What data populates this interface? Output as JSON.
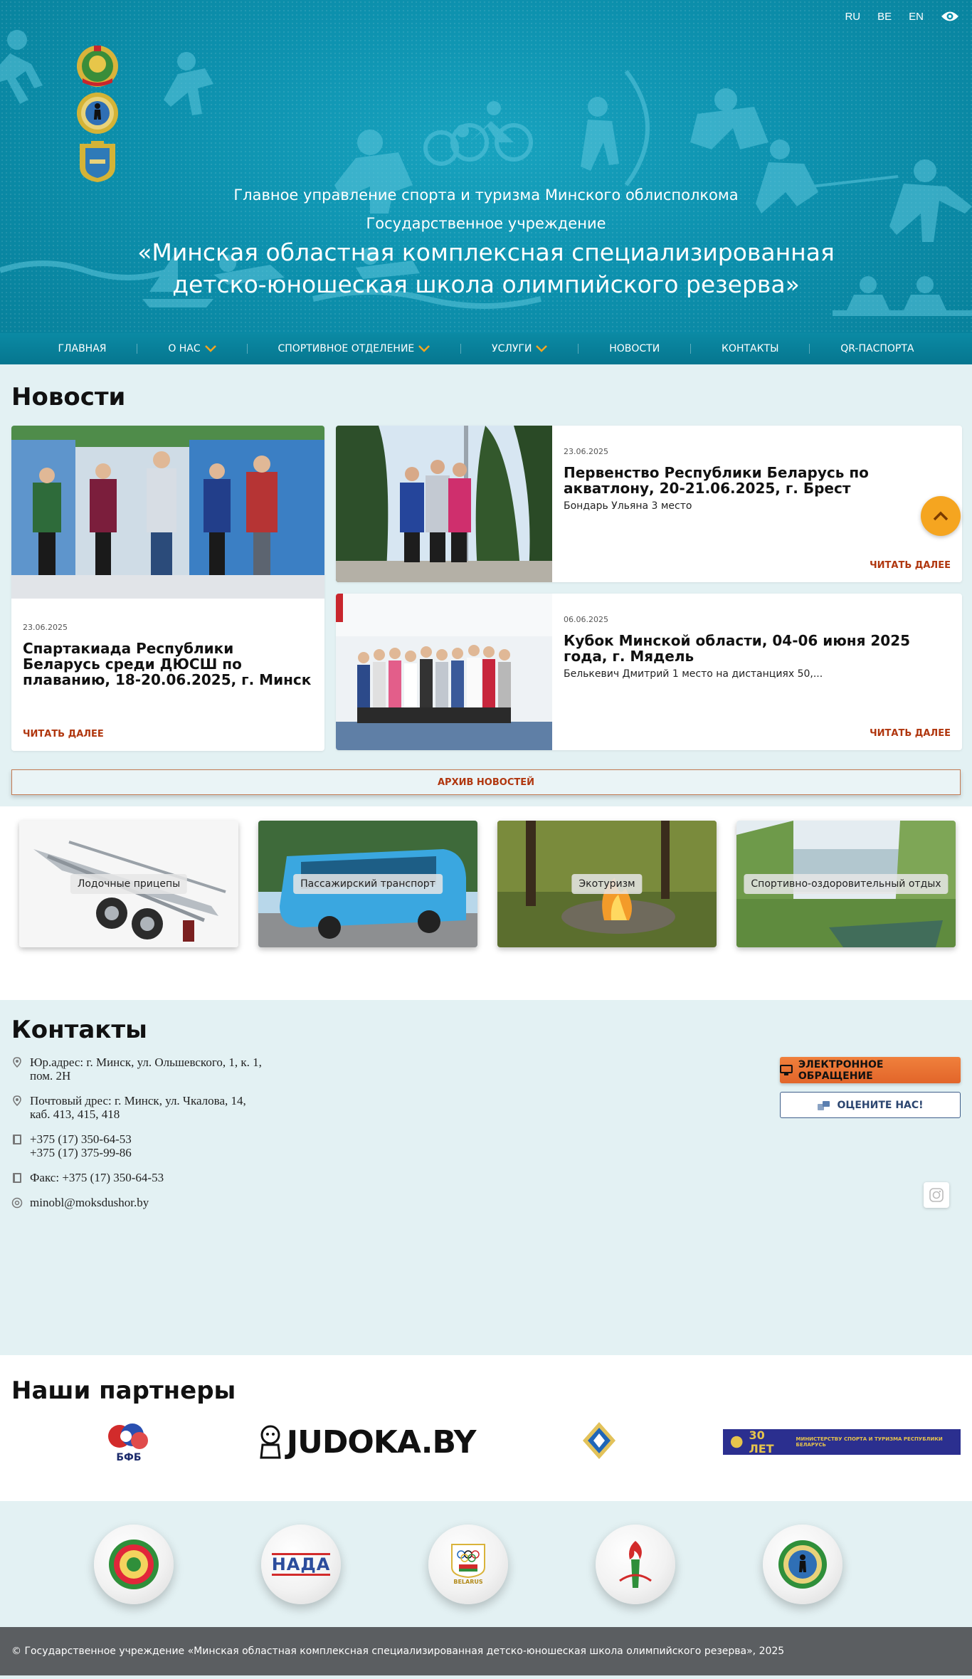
{
  "lang": [
    "RU",
    "BE",
    "EN"
  ],
  "header": {
    "line1": "Главное управление спорта и туризма Минского облисполкома",
    "line2": "Государственное учреждение",
    "line3": "«Минская областная комплексная специализированная детско-юношеская школа олимпийского резерва»"
  },
  "nav": [
    {
      "label": "Главная"
    },
    {
      "label": "О нас"
    },
    {
      "label": "Спортивное отделение"
    },
    {
      "label": "Услуги"
    },
    {
      "label": "Новости"
    },
    {
      "label": "Контакты"
    },
    {
      "label": "QR-паспорта"
    }
  ],
  "news": {
    "title": "Новости",
    "items": [
      {
        "date": "23.06.2025",
        "title": "Спартакиада Республики Беларусь среди ДЮСШ по плаванию, 18-20.06.2025, г. Минск",
        "excerpt": "",
        "more": "Читать далее"
      },
      {
        "date": "23.06.2025",
        "title": "Первенство Республики Беларусь по акватлону, 20-21.06.2025, г. Брест",
        "excerpt": "Бондарь Ульяна 3 место",
        "more": "Читать далее"
      },
      {
        "date": "06.06.2025",
        "title": "Кубок Минской области, 04-06 июня 2025 года, г. Мядель",
        "excerpt": "Белькевич Дмитрий 1 место на дистанциях 50,...",
        "more": "Читать далее"
      }
    ],
    "archive": "АРХИВ НОВОСТЕЙ"
  },
  "services": [
    {
      "label": "Лодочные прицепы"
    },
    {
      "label": "Пассажирский транспорт"
    },
    {
      "label": "Экотуризм"
    },
    {
      "label": "Спортивно-оздоровительный отдых"
    }
  ],
  "contacts": {
    "title": "Контакты",
    "legal_address": [
      "Юр.адрес: г. Минск, ул. Ольшевского, 1, к. 1,",
      "пом. 2Н"
    ],
    "postal_address": [
      "Почтовый дрес: г. Минск, ул. Чкалова, 14,",
      "каб. 413, 415, 418"
    ],
    "phones": [
      "+375 (17) 350-64-53",
      "+375 (17) 375-99-86"
    ],
    "fax": "Факс: +375 (17) 350-64-53",
    "email": "minobl@moksdushor.by",
    "appeal_button": "ЭЛЕКТРОННОЕ ОБРАЩЕНИЕ",
    "rate_button": "ОЦЕНИТЕ НАС!"
  },
  "partners": {
    "title": "Наши партнеры",
    "logo_bfb": "БФБ",
    "logo_judoka": "JUDOKA.BY",
    "logo_30": "30 ЛЕТ",
    "logo_30_sub": "МИНИСТЕРСТВУ СПОРТА И ТУРИЗМА РЕСПУБЛИКИ БЕЛАРУСЬ",
    "logo_nada": "НАДА",
    "logo_belarus": "BELARUS"
  },
  "footer": {
    "text": "© Государственное учреждение «Минская областная комплексная специализированная детско-юношеская школа олимпийского резерва», 2025"
  },
  "colors": {
    "header_bg": "#0d91ae",
    "accent_orange": "#e2652a",
    "link_red": "#b0360e",
    "scroll_top": "#f5a520",
    "footer_bg": "#5b5e61"
  }
}
